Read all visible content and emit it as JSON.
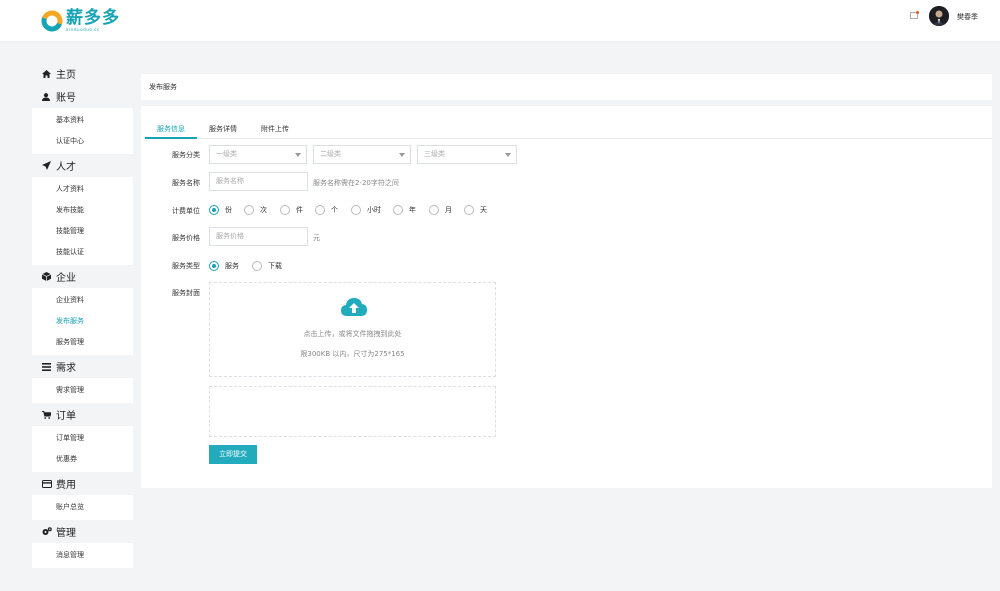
{
  "header": {
    "logo_title": "薪多多",
    "logo_sub": "xinduoduo.cc",
    "username": "樊春季"
  },
  "sidebar": {
    "sections": [
      {
        "label": "主页",
        "icon": "home-icon",
        "items": []
      },
      {
        "label": "账号",
        "icon": "user-icon",
        "items": [
          "基本资料",
          "认证中心"
        ]
      },
      {
        "label": "人才",
        "icon": "rocket-icon",
        "items": [
          "人才资料",
          "发布技能",
          "技能管理",
          "技能认证"
        ]
      },
      {
        "label": "企业",
        "icon": "cube-icon",
        "items": [
          "企业资料",
          "发布服务",
          "服务管理"
        ]
      },
      {
        "label": "需求",
        "icon": "list-icon",
        "items": [
          "需求管理"
        ]
      },
      {
        "label": "订单",
        "icon": "cart-icon",
        "items": [
          "订单管理",
          "优惠券"
        ]
      },
      {
        "label": "费用",
        "icon": "card-icon",
        "items": [
          "账户总览"
        ]
      },
      {
        "label": "管理",
        "icon": "gears-icon",
        "items": [
          "消息管理"
        ]
      }
    ],
    "active_item": "发布服务"
  },
  "breadcrumb": "发布服务",
  "tabs": [
    "服务信息",
    "服务详情",
    "附件上传"
  ],
  "form": {
    "category_label": "服务分类",
    "category_selects": [
      "一级类",
      "二级类",
      "三级类"
    ],
    "name_label": "服务名称",
    "name_placeholder": "服务名称",
    "name_hint": "服务名称需在2-20字符之间",
    "unit_label": "计费单位",
    "units": [
      "份",
      "次",
      "件",
      "个",
      "小时",
      "年",
      "月",
      "天"
    ],
    "unit_selected": "份",
    "price_label": "服务价格",
    "price_placeholder": "服务价格",
    "price_unit": "元",
    "type_label": "服务类型",
    "types": [
      "服务",
      "下载"
    ],
    "type_selected": "服务",
    "cover_label": "服务封面",
    "upload_text": "点击上传，或将文件拖拽到此处",
    "upload_limit": "限300KB 以内，尺寸为275*165",
    "submit_label": "立即提交"
  },
  "colors": {
    "accent": "#16a3b6",
    "button": "#22aabd",
    "background": "#f3f4f6"
  }
}
